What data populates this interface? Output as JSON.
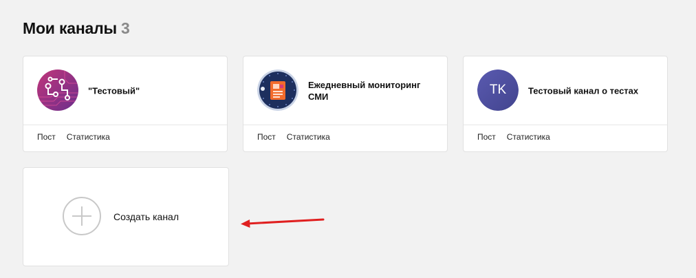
{
  "header": {
    "title": "Мои каналы",
    "count": "3"
  },
  "channels": [
    {
      "name": "\"Тестовый\"",
      "actions": [
        "Пост",
        "Статистика"
      ],
      "avatar": "circuit-logo"
    },
    {
      "name": "Ежедневный мониторинг СМИ",
      "actions": [
        "Пост",
        "Статистика"
      ],
      "avatar": "news-logo"
    },
    {
      "name": "Тестовый канал о тестах",
      "actions": [
        "Пост",
        "Статистика"
      ],
      "avatar_initials": "TK"
    }
  ],
  "create": {
    "label": "Создать канал"
  },
  "colors": {
    "annotation_arrow": "#e02020"
  }
}
